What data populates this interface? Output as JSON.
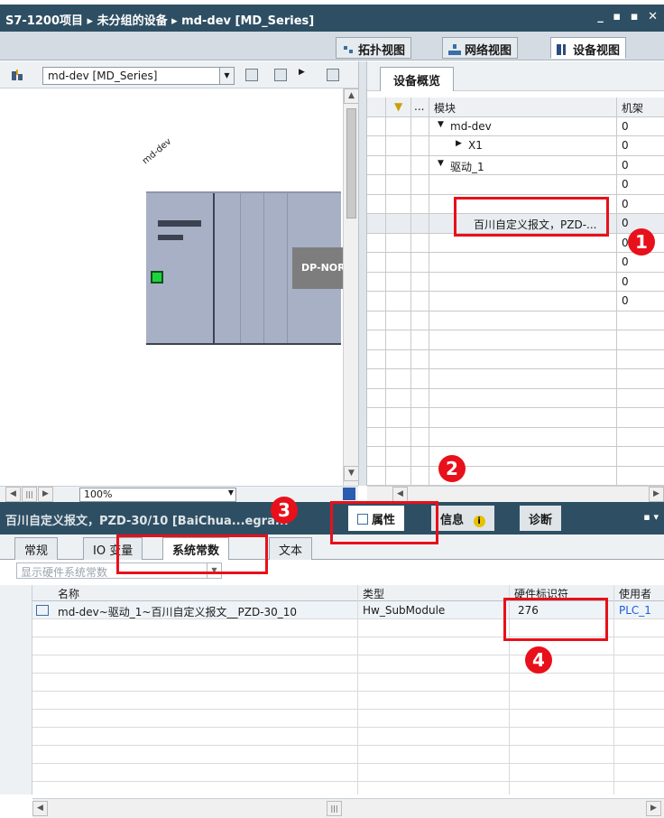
{
  "window": {
    "breadcrumb": "S7-1200项目 ▸ 未分组的设备 ▸ md-dev [MD_Series]",
    "controls": "_ ▪ ▪ ✕"
  },
  "view_tabs": [
    {
      "label": "拓扑视图",
      "icon": "topology-icon"
    },
    {
      "label": "网络视图",
      "icon": "network-icon"
    },
    {
      "label": "设备视图",
      "icon": "device-icon"
    }
  ],
  "toolbar": {
    "device_select": "md-dev [MD_Series]"
  },
  "canvas": {
    "device_label": "md-dev",
    "module_label": "DP-NOR"
  },
  "overview": {
    "tab": "设备概览",
    "columns": {
      "module": "模块",
      "rack": "机架",
      "dots": "..."
    },
    "rows": [
      {
        "name": "md-dev",
        "expander": "▼",
        "rack": "0"
      },
      {
        "name": "X1",
        "expander": "▶",
        "rack": "0"
      },
      {
        "name": "驱动_1",
        "expander": "▼",
        "rack": "0"
      },
      {
        "name": "",
        "expander": "",
        "rack": "0"
      },
      {
        "name": "",
        "expander": "",
        "rack": "0"
      },
      {
        "name": "百川自定义报文，PZD-...",
        "expander": "",
        "rack": "0"
      },
      {
        "name": "",
        "expander": "",
        "rack": "0"
      },
      {
        "name": "",
        "expander": "",
        "rack": "0"
      },
      {
        "name": "",
        "expander": "",
        "rack": "0"
      },
      {
        "name": "",
        "expander": "",
        "rack": "0"
      }
    ]
  },
  "zoom": "100%",
  "properties": {
    "title": "百川自定义报文，PZD-30/10 [BaiChua...egra...",
    "tabs": [
      "属性",
      "信息",
      "诊断"
    ],
    "sub_tabs": [
      "常规",
      "IO 变量",
      "系统常数",
      "文本"
    ],
    "filter_placeholder": "显示硬件系统常数"
  },
  "constants_table": {
    "headers": [
      "名称",
      "类型",
      "硬件标识符",
      "使用者"
    ],
    "rows": [
      {
        "name": "md-dev~驱动_1~百川自定义报文__PZD-30_10",
        "type": "Hw_SubModule",
        "hwid": "276",
        "user": "PLC_1"
      }
    ]
  },
  "annotations": [
    "1",
    "2",
    "3",
    "4"
  ],
  "colors": {
    "accent_red": "#e8101a",
    "titlebar": "#2e4f63",
    "link_blue": "#1a5fd6"
  }
}
